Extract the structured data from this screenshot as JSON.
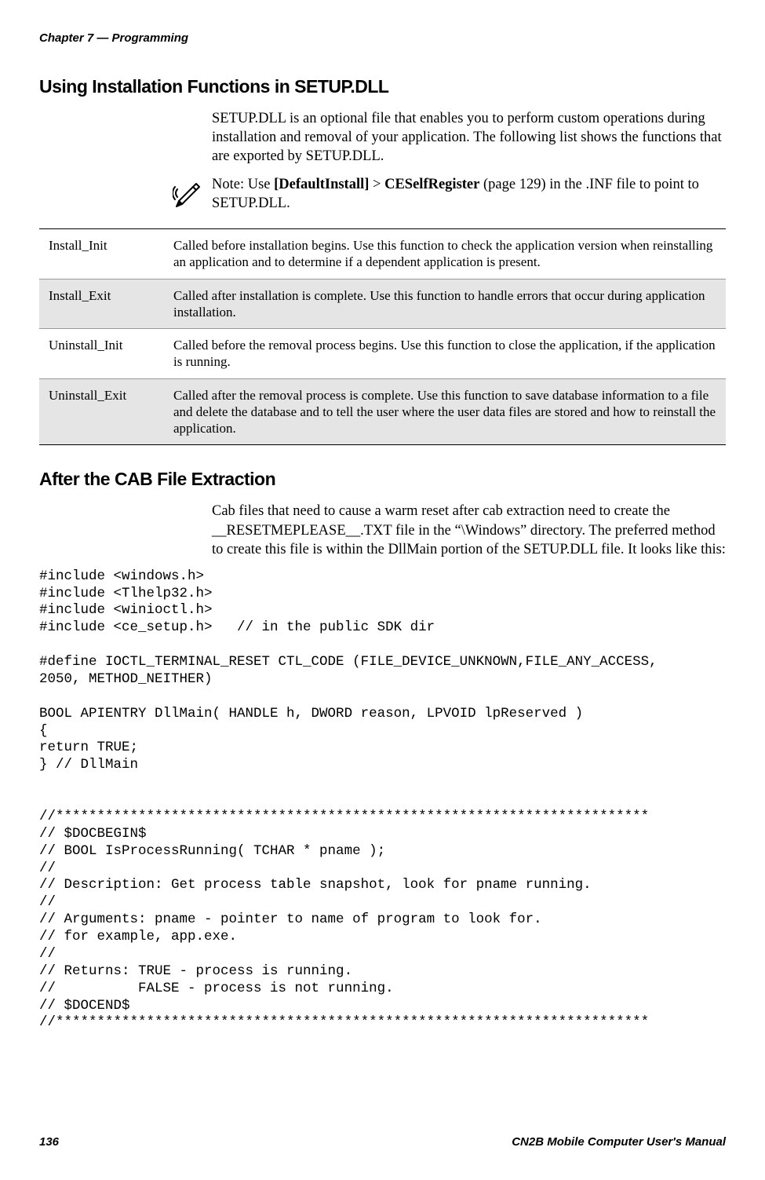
{
  "chapter_header": "Chapter 7 — Programming",
  "heading_setup": "Using Installation Functions in SETUP.DLL",
  "setup_body": "SETUP.DLL is an optional file that enables you to perform custom operations during installation and removal of your application. The following list shows the functions that are exported by SETUP.DLL.",
  "note_prefix": "Note: Use ",
  "note_brace_open": "[",
  "note_bold1": "DefaultInstall",
  "note_brace_close": "]",
  "note_gt": " > ",
  "note_bold2": "CESelfRegister",
  "note_page": " (page 129) in the .INF file to point to SETUP.DLL.",
  "table": [
    {
      "name": "Install_Init",
      "desc": "Called before installation begins. Use this function to check the application version when reinstalling an application and to determine if a dependent application is present."
    },
    {
      "name": "Install_Exit",
      "desc": "Called after installation is complete. Use this function to handle errors that occur during application installation."
    },
    {
      "name": "Uninstall_Init",
      "desc": "Called before the removal process begins. Use this function to close the application, if the application is running."
    },
    {
      "name": "Uninstall_Exit",
      "desc": "Called after the removal process is complete. Use this function to save database information to a file and delete the database and to tell the user where the user data files are stored and how to reinstall the application."
    }
  ],
  "heading_cab": "After the CAB File Extraction",
  "cab_body": "Cab files that need to cause a warm reset after cab extraction need to create the __RESETMEPLEASE__.TXT file in the “\\Windows” directory. The preferred method to create this file is within the DllMain portion of the SETUP.DLL file. It looks like this:",
  "code": "#include <windows.h>\n#include <Tlhelp32.h>\n#include <winioctl.h>\n#include <ce_setup.h>   // in the public SDK dir\n\n#define IOCTL_TERMINAL_RESET CTL_CODE (FILE_DEVICE_UNKNOWN,FILE_ANY_ACCESS,\n2050, METHOD_NEITHER)\n\nBOOL APIENTRY DllMain( HANDLE h, DWORD reason, LPVOID lpReserved )\n{\nreturn TRUE;\n} // DllMain\n\n\n//************************************************************************\n// $DOCBEGIN$\n// BOOL IsProcessRunning( TCHAR * pname );\n//\n// Description: Get process table snapshot, look for pname running.\n//\n// Arguments: pname - pointer to name of program to look for.\n// for example, app.exe.\n//\n// Returns: TRUE - process is running.\n//          FALSE - process is not running.\n// $DOCEND$\n//************************************************************************",
  "page_number": "136",
  "manual_title": "CN2B Mobile Computer User's Manual"
}
